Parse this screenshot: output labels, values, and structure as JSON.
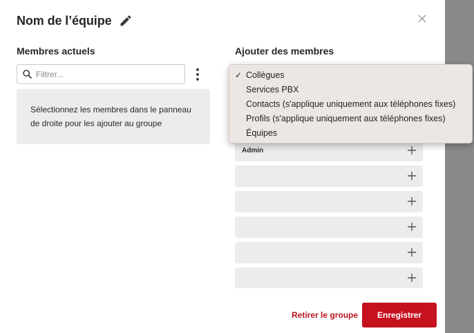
{
  "dialog": {
    "title": "Nom de l’équipe",
    "left_section_title": "Membres actuels",
    "right_section_title": "Ajouter des membres",
    "search": {
      "placeholder": "Filtrer...",
      "value": ""
    },
    "info_line1": "Sélectionnez les membres dans le panneau",
    "info_line2": "de droite pour les ajouter au groupe",
    "members": [
      {
        "name": "Admin"
      },
      {
        "name": ""
      },
      {
        "name": ""
      },
      {
        "name": ""
      },
      {
        "name": ""
      },
      {
        "name": ""
      }
    ],
    "dropdown": {
      "selected": "Collègues",
      "options": [
        "Collègues",
        "Services PBX",
        "Contacts (s'applique uniquement aux téléphones fixes)",
        "Profils (s'applique uniquement aux téléphones fixes)",
        "Équipes"
      ]
    },
    "remove_label": "Retirer le groupe",
    "save_label": "Enregistrer",
    "colors": {
      "accent": "#c6111e",
      "link": "#b8141f",
      "panel": "#ececec",
      "overlay": "#8a8a8a"
    },
    "icons": {
      "edit": "pencil-icon",
      "close": "close-icon",
      "search": "search-icon",
      "more": "kebab-menu-icon",
      "add": "plus-icon",
      "check": "check-icon"
    }
  }
}
